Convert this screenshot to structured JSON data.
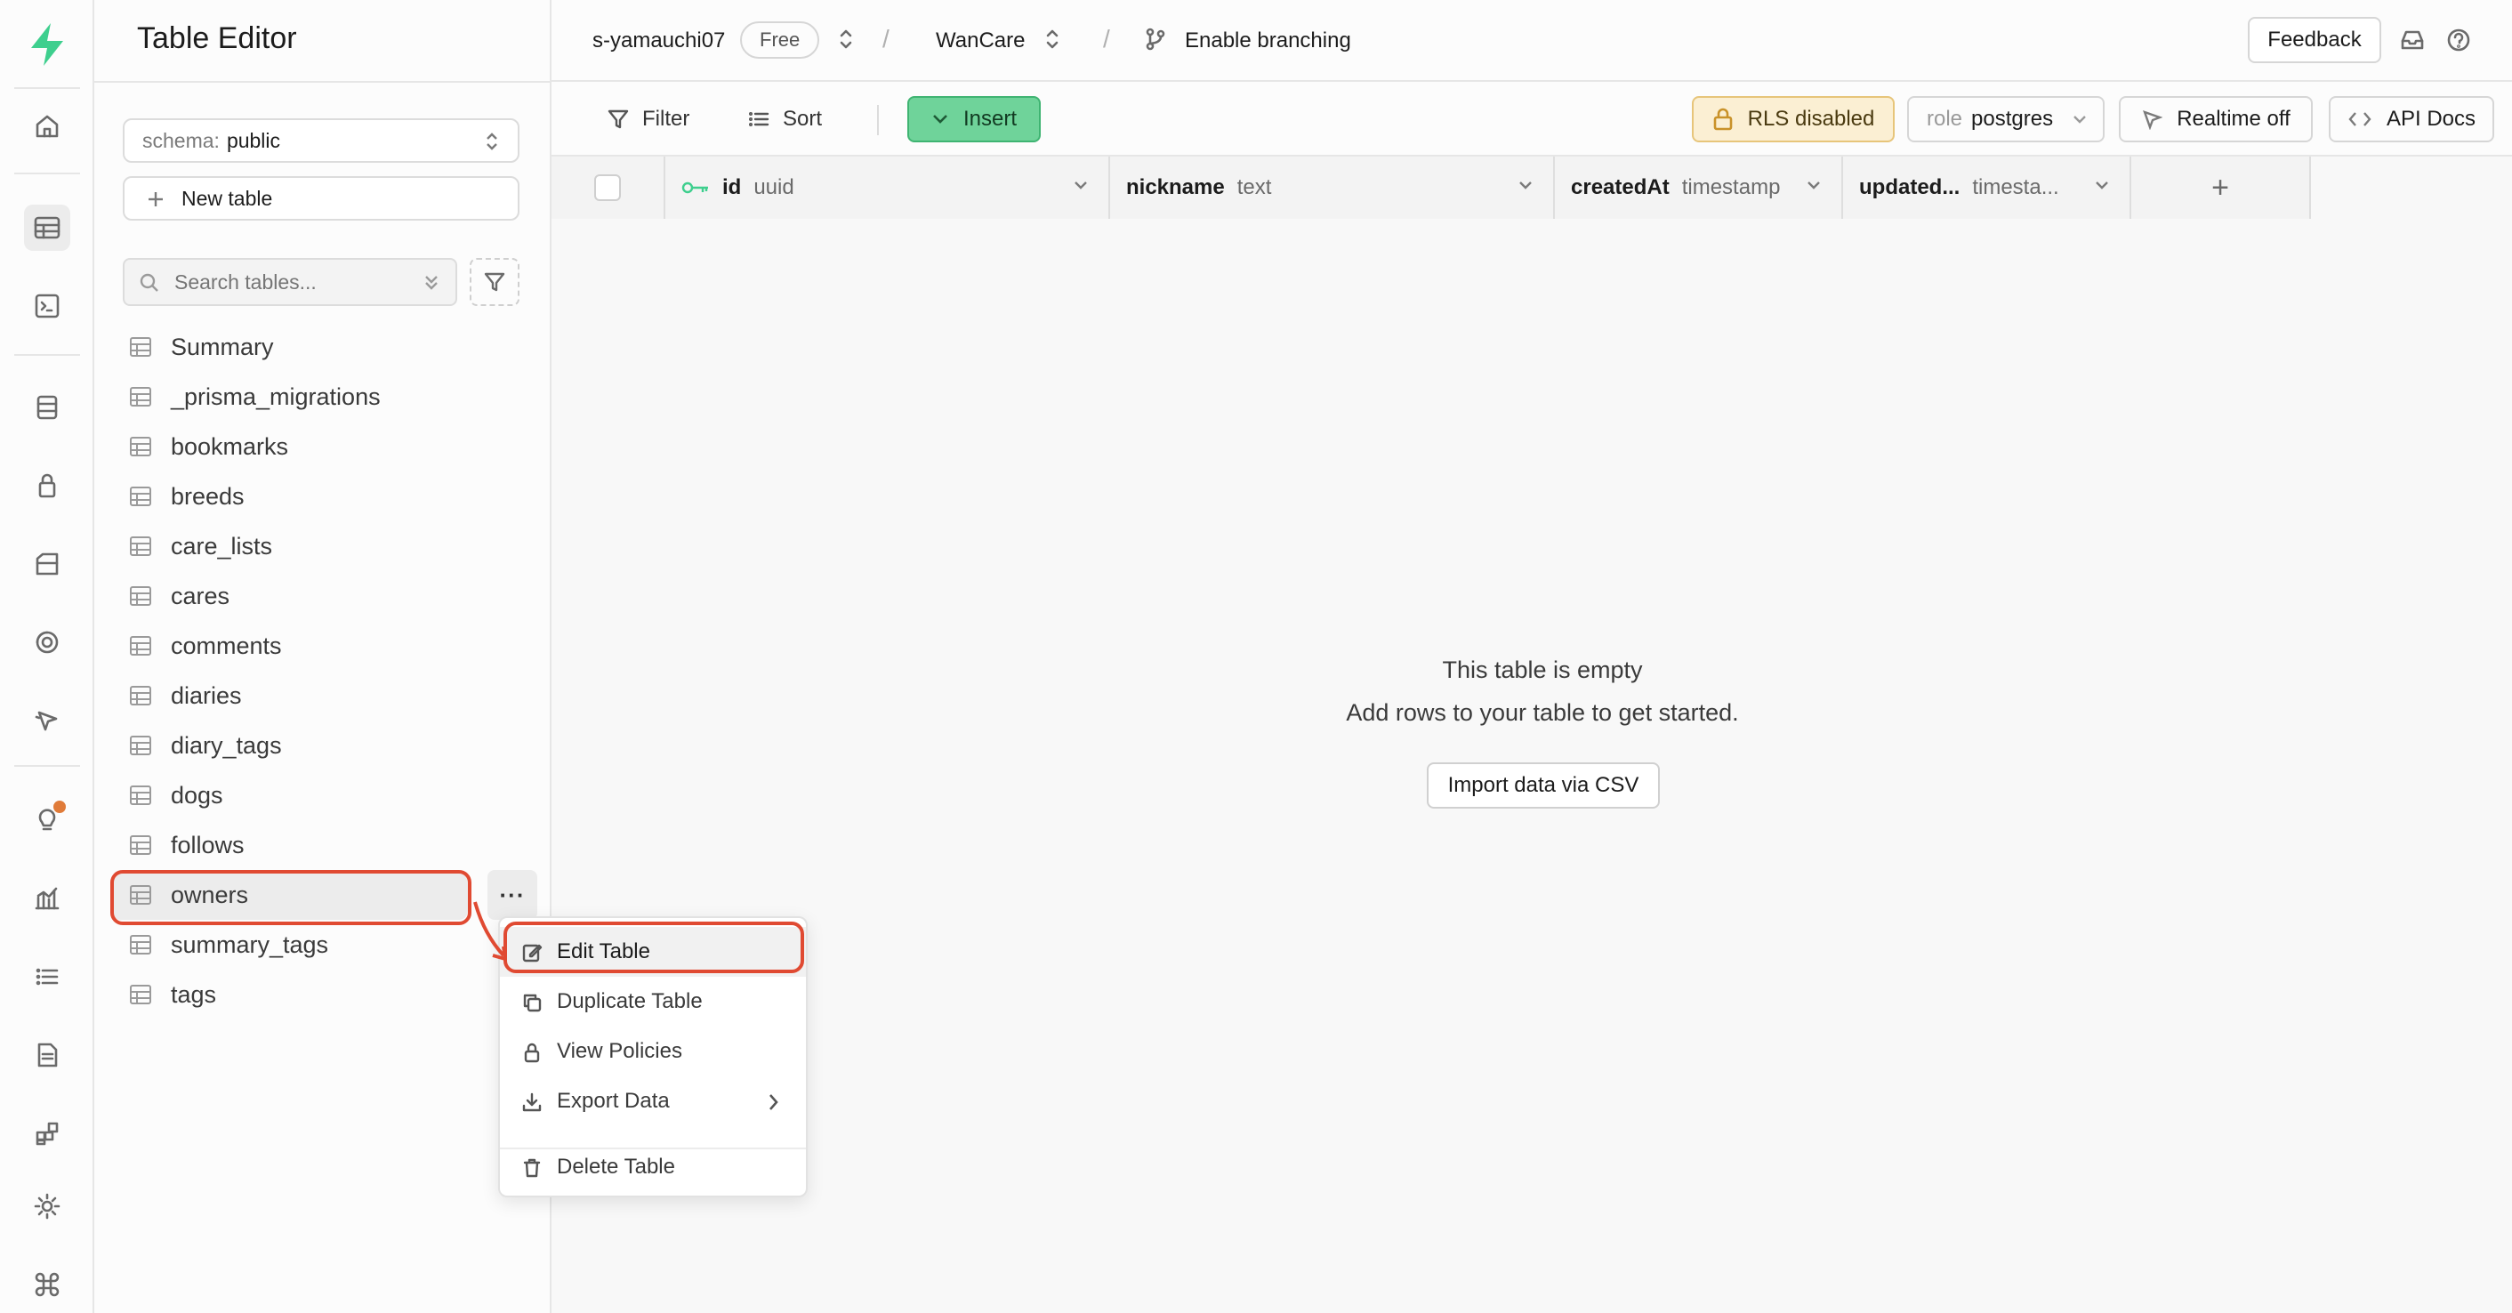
{
  "sidebar": {
    "title": "Table Editor",
    "schema_label": "schema:",
    "schema_value": "public",
    "new_table_label": "New table",
    "search_placeholder": "Search tables...",
    "tables": [
      "Summary",
      "_prisma_migrations",
      "bookmarks",
      "breeds",
      "care_lists",
      "cares",
      "comments",
      "diaries",
      "diary_tags",
      "dogs",
      "follows",
      "owners",
      "summary_tags",
      "tags"
    ],
    "selected_table": "owners"
  },
  "topbar": {
    "org": "s-yamauchi07",
    "plan": "Free",
    "project": "WanCare",
    "branch": "Enable branching",
    "feedback": "Feedback"
  },
  "toolbar": {
    "filter": "Filter",
    "sort": "Sort",
    "insert": "Insert",
    "rls": "RLS disabled",
    "role_label": "role",
    "role_value": "postgres",
    "realtime": "Realtime off",
    "api_docs": "API Docs"
  },
  "grid": {
    "columns": [
      {
        "name": "id",
        "type": "uuid"
      },
      {
        "name": "nickname",
        "type": "text"
      },
      {
        "name": "createdAt",
        "type": "timestamp"
      },
      {
        "name": "updated...",
        "type": "timesta..."
      }
    ],
    "add_column": "+"
  },
  "empty_state": {
    "title": "This table is empty",
    "subtitle": "Add rows to your table to get started.",
    "import_button": "Import data via CSV"
  },
  "context_menu": {
    "items": [
      "Edit Table",
      "Duplicate Table",
      "View Policies",
      "Export Data",
      "Delete Table"
    ]
  },
  "colors": {
    "brand_green": "#3ecf8e",
    "insert_bg": "#6fd39a",
    "rls_bg": "#fbefd3",
    "annotation_red": "#e04a32"
  }
}
